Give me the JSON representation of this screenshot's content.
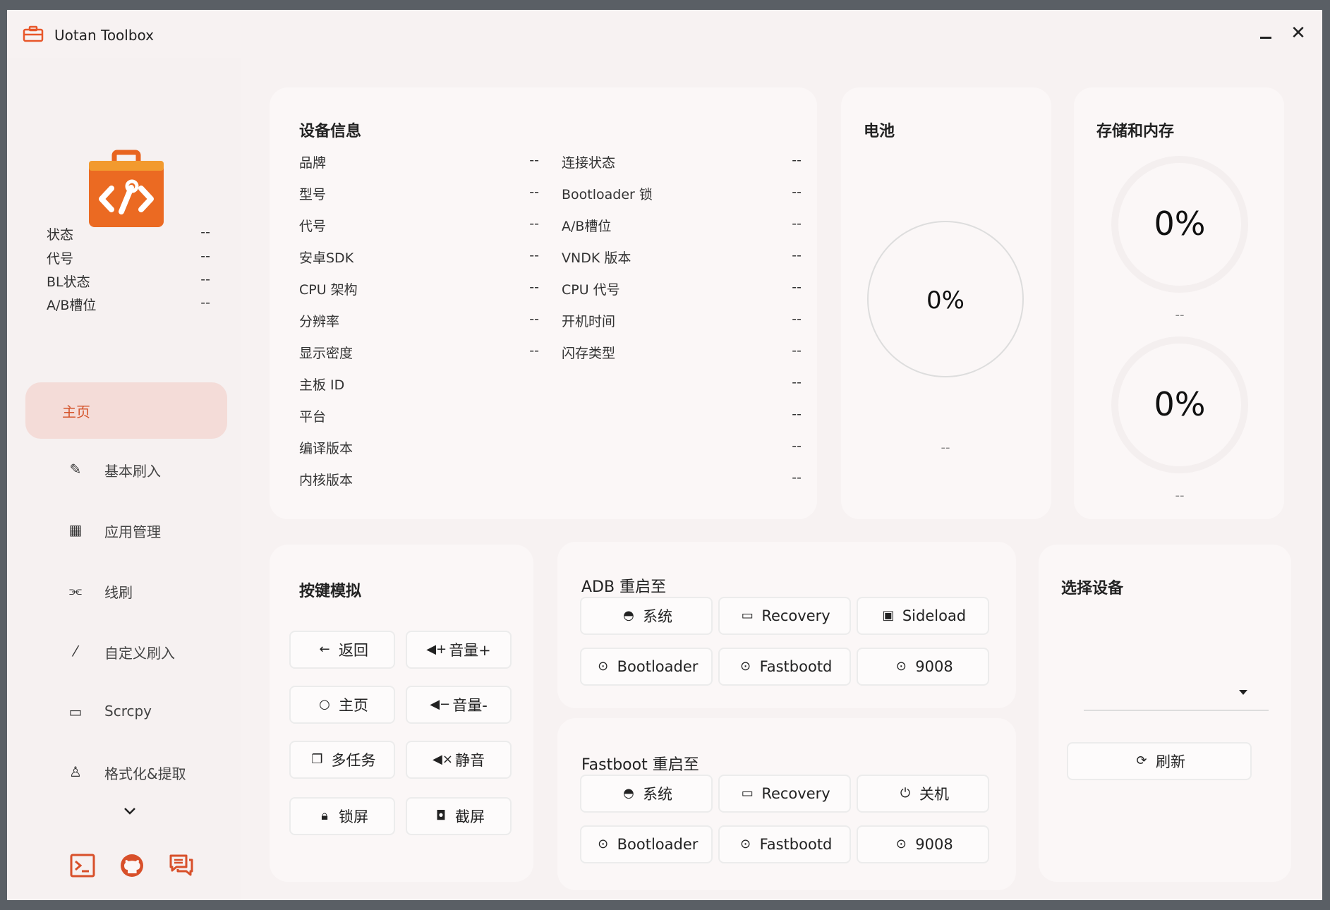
{
  "window": {
    "title": "Uotan Toolbox",
    "minimize_label": "minimize",
    "close_glyph": "✕"
  },
  "sidebar": {
    "info": [
      {
        "label": "状态",
        "value": "--"
      },
      {
        "label": "代号",
        "value": "--"
      },
      {
        "label": "BL状态",
        "value": "--"
      },
      {
        "label": "A/B槽位",
        "value": "--"
      }
    ],
    "nav": [
      {
        "label": "主页",
        "icon": "home-icon",
        "active": true
      },
      {
        "label": "基本刷入",
        "icon": "flash-icon"
      },
      {
        "label": "应用管理",
        "icon": "apps-grid-icon"
      },
      {
        "label": "线刷",
        "icon": "cable-icon"
      },
      {
        "label": "自定义刷入",
        "icon": "magic-wand-icon"
      },
      {
        "label": "Scrcpy",
        "icon": "devices-icon"
      },
      {
        "label": "格式化&提取",
        "icon": "person-icon"
      }
    ],
    "footer_icons": [
      "terminal-icon",
      "github-icon",
      "chat-icon"
    ]
  },
  "device_info": {
    "title": "设备信息",
    "left": [
      {
        "label": "品牌",
        "value": "--"
      },
      {
        "label": "型号",
        "value": "--"
      },
      {
        "label": "代号",
        "value": "--"
      },
      {
        "label": "安卓SDK",
        "value": "--"
      },
      {
        "label": "CPU 架构",
        "value": "--"
      },
      {
        "label": "分辨率",
        "value": "--"
      },
      {
        "label": "显示密度",
        "value": "--"
      }
    ],
    "right": [
      {
        "label": "连接状态",
        "value": "--"
      },
      {
        "label": "Bootloader 锁",
        "value": "--"
      },
      {
        "label": "A/B槽位",
        "value": "--"
      },
      {
        "label": "VNDK 版本",
        "value": "--"
      },
      {
        "label": "CPU 代号",
        "value": "--"
      },
      {
        "label": "开机时间",
        "value": "--"
      },
      {
        "label": "闪存类型",
        "value": "--"
      }
    ],
    "full": [
      {
        "label": "主板 ID",
        "value": "--"
      },
      {
        "label": "平台",
        "value": "--"
      },
      {
        "label": "编译版本",
        "value": "--"
      },
      {
        "label": "内核版本",
        "value": "--"
      }
    ]
  },
  "battery": {
    "title": "电池",
    "percent": "0%",
    "status": "--"
  },
  "storage": {
    "title": "存储和内存",
    "storage_percent": "0%",
    "storage_detail": "--",
    "memory_percent": "0%",
    "memory_detail": "--"
  },
  "keys": {
    "title": "按键模拟",
    "buttons": [
      {
        "label": "返回",
        "icon": "arrow-left-icon"
      },
      {
        "label": "音量+",
        "icon": "volume-up-icon"
      },
      {
        "label": "主页",
        "icon": "circle-icon"
      },
      {
        "label": "音量-",
        "icon": "volume-down-icon"
      },
      {
        "label": "多任务",
        "icon": "multitask-icon"
      },
      {
        "label": "静音",
        "icon": "mute-icon"
      },
      {
        "label": "锁屏",
        "icon": "lock-icon"
      },
      {
        "label": "截屏",
        "icon": "camera-icon"
      }
    ]
  },
  "adb_reboot": {
    "title": "ADB 重启至",
    "buttons": [
      {
        "label": "系统",
        "icon": "android-icon"
      },
      {
        "label": "Recovery",
        "icon": "laptop-icon"
      },
      {
        "label": "Sideload",
        "icon": "monitor-icon"
      },
      {
        "label": "Bootloader",
        "icon": "download-circle-icon"
      },
      {
        "label": "Fastbootd",
        "icon": "download-circle-icon"
      },
      {
        "label": "9008",
        "icon": "download-circle-icon"
      }
    ]
  },
  "fastboot_reboot": {
    "title": "Fastboot 重启至",
    "buttons": [
      {
        "label": "系统",
        "icon": "android-icon"
      },
      {
        "label": "Recovery",
        "icon": "laptop-icon"
      },
      {
        "label": "关机",
        "icon": "power-icon"
      },
      {
        "label": "Bootloader",
        "icon": "download-circle-icon"
      },
      {
        "label": "Fastbootd",
        "icon": "download-circle-icon"
      },
      {
        "label": "9008",
        "icon": "download-circle-icon"
      }
    ]
  },
  "select_device": {
    "title": "选择设备",
    "selected": "",
    "refresh_label": "刷新"
  },
  "colors": {
    "accent": "#e8572a",
    "active_bg": "#f4dcd8",
    "card_bg": "#fbf7f7"
  }
}
